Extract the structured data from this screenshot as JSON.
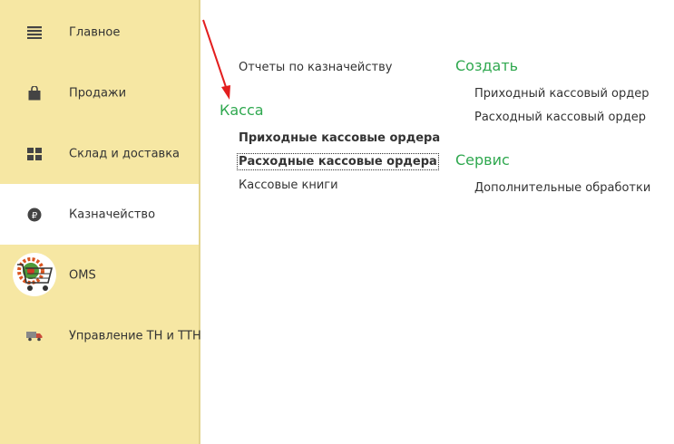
{
  "sidebar": {
    "items": [
      {
        "label": "Главное",
        "icon": "menu-lines-icon"
      },
      {
        "label": "Продажи",
        "icon": "shopping-bag-icon"
      },
      {
        "label": "Склад и доставка",
        "icon": "warehouse-grid-icon"
      },
      {
        "label": "Казначейство",
        "icon": "ruble-coin-icon",
        "active": true
      },
      {
        "label": "OMS",
        "icon": "oms-cart-logo-icon"
      },
      {
        "label": "Управление ТН и ТТН",
        "icon": "delivery-truck-icon"
      }
    ]
  },
  "main": {
    "reports_link": "Отчеты по казначейству",
    "kassa": {
      "title": "Касса",
      "links": [
        "Приходные кассовые ордера",
        "Расходные кассовые ордера",
        "Кассовые книги"
      ]
    },
    "create": {
      "title": "Создать",
      "links": [
        "Приходный кассовый ордер",
        "Расходный кассовый ордер"
      ]
    },
    "service": {
      "title": "Сервис",
      "links": [
        "Дополнительные обработки"
      ]
    }
  },
  "colors": {
    "sidebar_bg": "#f6e7a3",
    "section_title": "#2fa84f",
    "annotation_arrow": "#e31e1e"
  }
}
